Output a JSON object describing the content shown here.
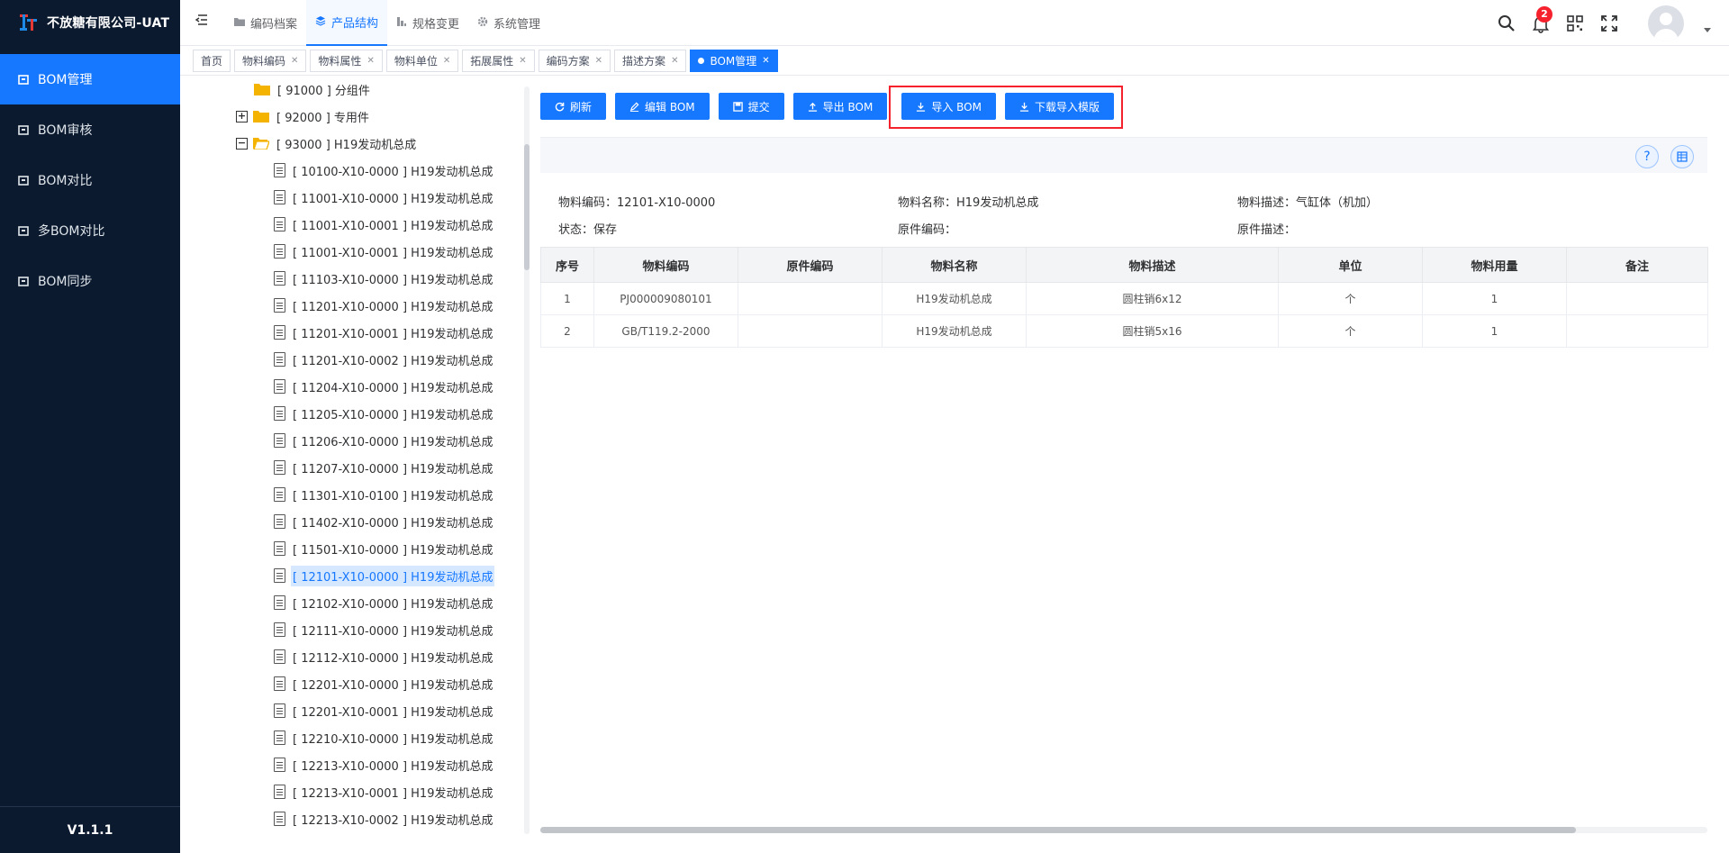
{
  "brand": {
    "title": "不放糖有限公司-UAT"
  },
  "sidebar": {
    "items": [
      {
        "label": "BOM管理",
        "active": true
      },
      {
        "label": "BOM审核",
        "active": false
      },
      {
        "label": "BOM对比",
        "active": false
      },
      {
        "label": "多BOM对比",
        "active": false
      },
      {
        "label": "BOM同步",
        "active": false
      }
    ],
    "version": "V1.1.1"
  },
  "header": {
    "nav": [
      {
        "label": "编码档案",
        "icon": "folder-icon",
        "active": false
      },
      {
        "label": "产品结构",
        "icon": "layers-icon",
        "active": true
      },
      {
        "label": "规格变更",
        "icon": "steps-icon",
        "active": false
      },
      {
        "label": "系统管理",
        "icon": "gear-icon",
        "active": false
      }
    ],
    "notification_count": "2"
  },
  "tags": [
    {
      "label": "首页",
      "closable": false,
      "active": false
    },
    {
      "label": "物料编码",
      "closable": true,
      "active": false
    },
    {
      "label": "物料属性",
      "closable": true,
      "active": false
    },
    {
      "label": "物料单位",
      "closable": true,
      "active": false
    },
    {
      "label": "拓展属性",
      "closable": true,
      "active": false
    },
    {
      "label": "编码方案",
      "closable": true,
      "active": false
    },
    {
      "label": "描述方案",
      "closable": true,
      "active": false
    },
    {
      "label": "BOM管理",
      "closable": true,
      "active": true
    }
  ],
  "tree": {
    "groups": [
      {
        "label": "[ 91000 ] 分组件",
        "toggle": ""
      },
      {
        "label": "[ 92000 ] 专用件",
        "toggle": "+"
      },
      {
        "label": "[ 93000 ] H19发动机总成",
        "toggle": "−"
      }
    ],
    "leaves": [
      "[ 10100-X10-0000 ] H19发动机总成",
      "[ 11001-X10-0000 ] H19发动机总成",
      "[ 11001-X10-0001 ] H19发动机总成",
      "[ 11001-X10-0001 ] H19发动机总成",
      "[ 11103-X10-0000 ] H19发动机总成",
      "[ 11201-X10-0000 ] H19发动机总成",
      "[ 11201-X10-0001 ] H19发动机总成",
      "[ 11201-X10-0002 ] H19发动机总成",
      "[ 11204-X10-0000 ] H19发动机总成",
      "[ 11205-X10-0000 ] H19发动机总成",
      "[ 11206-X10-0000 ] H19发动机总成",
      "[ 11207-X10-0000 ] H19发动机总成",
      "[ 11301-X10-0100 ] H19发动机总成",
      "[ 11402-X10-0000 ] H19发动机总成",
      "[ 11501-X10-0000 ] H19发动机总成",
      "[ 12101-X10-0000 ] H19发动机总成",
      "[ 12102-X10-0000 ] H19发动机总成",
      "[ 12111-X10-0000 ] H19发动机总成",
      "[ 12112-X10-0000 ] H19发动机总成",
      "[ 12201-X10-0000 ] H19发动机总成",
      "[ 12201-X10-0001 ] H19发动机总成",
      "[ 12210-X10-0000 ] H19发动机总成",
      "[ 12213-X10-0000 ] H19发动机总成",
      "[ 12213-X10-0001 ] H19发动机总成",
      "[ 12213-X10-0002 ] H19发动机总成"
    ],
    "selected_leaf": "[ 12101-X10-0000 ] H19发动机总成"
  },
  "toolbar": {
    "refresh": "刷新",
    "edit": "编辑 BOM",
    "submit": "提交",
    "export": "导出 BOM",
    "import": "导入 BOM",
    "download_template": "下载导入模版"
  },
  "detail": {
    "material_code_label": "物料编码：",
    "material_code": "12101-X10-0000",
    "material_name_label": "物料名称：",
    "material_name": "H19发动机总成",
    "material_desc_label": "物料描述：",
    "material_desc": "气缸体（机加）",
    "status_label": "状态：",
    "status": "保存",
    "orig_code_label": "原件编码：",
    "orig_code": "",
    "orig_desc_label": "原件描述：",
    "orig_desc": ""
  },
  "table": {
    "headers": [
      "序号",
      "物料编码",
      "原件编码",
      "物料名称",
      "物料描述",
      "单位",
      "物料用量",
      "备注"
    ],
    "rows": [
      [
        "1",
        "PJ000009080101",
        "",
        "H19发动机总成",
        "圆柱销6x12",
        "个",
        "1",
        ""
      ],
      [
        "2",
        "GB/T119.2-2000",
        "",
        "H19发动机总成",
        "圆柱销5x16",
        "个",
        "1",
        ""
      ]
    ]
  },
  "colors": {
    "accent": "#1677ff",
    "sidebar_bg": "#0b1a2f",
    "highlight": "#f5222d"
  }
}
